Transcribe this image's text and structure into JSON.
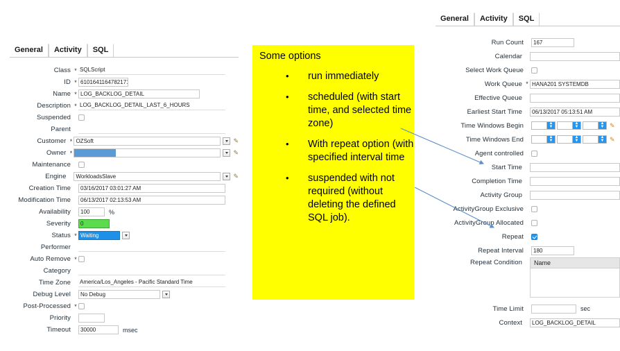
{
  "left_panel": {
    "tabs": [
      {
        "label": "General",
        "active": true
      },
      {
        "label": "Activity",
        "active": false
      },
      {
        "label": "SQL",
        "active": false
      }
    ],
    "fields": [
      {
        "label": "Class",
        "required": true,
        "type": "text",
        "value": "SQLScript"
      },
      {
        "label": "ID",
        "required": true,
        "type": "text",
        "value": "6101641164782171"
      },
      {
        "label": "Name",
        "required": true,
        "type": "text",
        "value": "LOG_BACKLOG_DETAIL"
      },
      {
        "label": "Description",
        "required": true,
        "type": "text",
        "value": "LOG_BACKLOG_DETAIL_LAST_6_HOURS"
      },
      {
        "label": "Suspended",
        "required": false,
        "type": "checkbox",
        "checked": false
      },
      {
        "label": "Parent",
        "required": false,
        "type": "text",
        "value": ""
      },
      {
        "label": "Customer",
        "required": true,
        "type": "lookup",
        "value": "OZSoft"
      },
      {
        "label": "Owner",
        "required": true,
        "type": "lookup",
        "value": "",
        "redacted": true
      },
      {
        "label": "Maintenance",
        "required": false,
        "type": "checkbox",
        "checked": false
      },
      {
        "label": "Engine",
        "required": false,
        "type": "lookup",
        "value": "WorkloadsSlave"
      },
      {
        "label": "Creation Time",
        "required": false,
        "type": "text",
        "value": "03/16/2017 03:01:27 AM"
      },
      {
        "label": "Modification Time",
        "required": false,
        "type": "text",
        "value": "06/13/2017 02:13:53 AM"
      },
      {
        "label": "Availability",
        "required": false,
        "type": "text",
        "value": "100",
        "unit": "%"
      },
      {
        "label": "Severity",
        "required": false,
        "type": "text",
        "value": "0",
        "fill": "green"
      },
      {
        "label": "Status",
        "required": true,
        "type": "select",
        "value": "Waiting",
        "fill": "blue"
      },
      {
        "label": "Performer",
        "required": false,
        "type": "text",
        "value": ""
      },
      {
        "label": "Auto Remove",
        "required": true,
        "type": "checkbox",
        "checked": false
      },
      {
        "label": "Category",
        "required": false,
        "type": "text",
        "value": ""
      },
      {
        "label": "Time Zone",
        "required": false,
        "type": "text",
        "value": "America/Los_Angeles - Pacific Standard Time"
      },
      {
        "label": "Debug Level",
        "required": false,
        "type": "select",
        "value": "No Debug"
      },
      {
        "label": "Post-Processed",
        "required": true,
        "type": "checkbox",
        "checked": false
      },
      {
        "label": "Priority",
        "required": false,
        "type": "text",
        "value": ""
      },
      {
        "label": "Timeout",
        "required": false,
        "type": "text",
        "value": "30000",
        "unit": "msec"
      }
    ]
  },
  "right_panel": {
    "tabs": [
      {
        "label": "General",
        "active": false
      },
      {
        "label": "Activity",
        "active": true
      },
      {
        "label": "SQL",
        "active": false
      }
    ],
    "fields": [
      {
        "label": "Run Count",
        "required": false,
        "type": "text",
        "value": "167"
      },
      {
        "label": "Calendar",
        "required": false,
        "type": "text",
        "value": ""
      },
      {
        "label": "Select Work Queue",
        "required": false,
        "type": "checkbox",
        "checked": false
      },
      {
        "label": "Work Queue",
        "required": true,
        "type": "text",
        "value": "HANA201 SYSTEMDB"
      },
      {
        "label": "Effective Queue",
        "required": false,
        "type": "text",
        "value": ""
      },
      {
        "label": "Earliest Start Time",
        "required": false,
        "type": "text",
        "value": "06/13/2017 05:13:51 AM"
      },
      {
        "label": "Time Windows Begin",
        "required": false,
        "type": "spinners",
        "values": [
          "",
          "",
          ""
        ]
      },
      {
        "label": "Time Windows End",
        "required": false,
        "type": "spinners",
        "values": [
          "",
          "",
          ""
        ]
      },
      {
        "label": "Agent controlled",
        "required": false,
        "type": "checkbox",
        "checked": false
      },
      {
        "label": "Start Time",
        "required": false,
        "type": "text",
        "value": ""
      },
      {
        "label": "Completion Time",
        "required": false,
        "type": "text",
        "value": ""
      },
      {
        "label": "Activity Group",
        "required": false,
        "type": "text",
        "value": ""
      },
      {
        "label": "ActivityGroup Exclusive",
        "required": false,
        "type": "checkbox",
        "checked": false
      },
      {
        "label": "ActivityGroup Allocated",
        "required": false,
        "type": "checkbox",
        "checked": false
      },
      {
        "label": "Repeat",
        "required": false,
        "type": "checkbox",
        "checked": true
      },
      {
        "label": "Repeat Interval",
        "required": false,
        "type": "text",
        "value": "180"
      },
      {
        "label": "Repeat Condition",
        "required": false,
        "type": "listbox",
        "column": "Name",
        "rows": []
      },
      {
        "label": "Time Limit",
        "required": false,
        "type": "text",
        "value": "",
        "unit": "sec"
      },
      {
        "label": "Context",
        "required": false,
        "type": "text",
        "value": "LOG_BACKLOG_DETAIL"
      }
    ]
  },
  "callout": {
    "background": "#ffff00",
    "title": "Some options",
    "bullets": [
      "run immediately",
      "scheduled (with start time, and selected time zone)",
      "With repeat option (with specified interval time",
      "suspended with not required (without deleting the defined SQL job)."
    ]
  },
  "arrows": {
    "color": "#5b8fc9",
    "items": [
      {
        "label": "arrow-to-start-time",
        "from": [
          578,
          185
        ],
        "to": [
          697,
          236
        ]
      },
      {
        "label": "arrow-to-repeat",
        "from": [
          598,
          270
        ],
        "to": [
          712,
          328
        ]
      }
    ]
  }
}
